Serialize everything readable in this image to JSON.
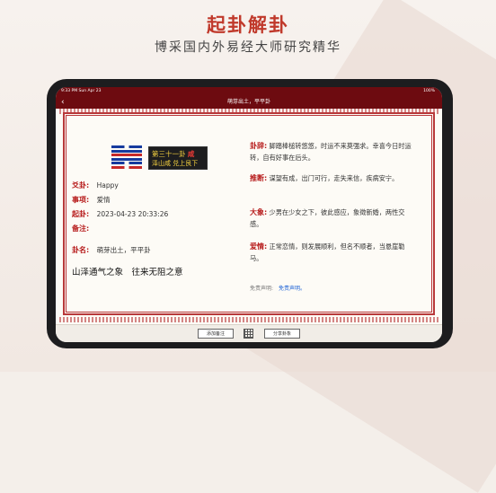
{
  "promo": {
    "headline": "起卦解卦",
    "subheadline": "博采国内外易经大师研究精华"
  },
  "status_bar": {
    "time": "9:33 PM  Sun Apr 23",
    "battery": "100%"
  },
  "nav": {
    "back": "‹",
    "title": "萌芽出土，平平卦"
  },
  "hexagram": {
    "title_prefix": "第三十一卦",
    "title_name": "咸",
    "subtitle": "泽山咸 兑上艮下"
  },
  "details": {
    "asker_label": "爻卦:",
    "asker_value": "Happy",
    "matter_label": "事项:",
    "matter_value": "爱情",
    "time_label": "起卦:",
    "time_value": "2023-04-23 20:33:26",
    "note_label": "备注:",
    "name_label": "卦名:",
    "name_value": "萌芽出土，平平卦",
    "summary": "山泽通气之象　往来无阻之意"
  },
  "interpretation": {
    "guaci_label": "卦辞:",
    "guaci_text": "脚踏棒槌转悠悠，时运不来莫强求。幸喜今日时运转，自有好事在后头。",
    "tuiduan_label": "推断:",
    "tuiduan_text": "谋望有成，出门可行，走失来信，疾病安宁。",
    "daxiang_label": "大象:",
    "daxiang_text": "少男在少女之下，彼此感应，象徵新婚，两性交感。",
    "aiqing_label": "爱情:",
    "aiqing_text": "正常恋情，则发展顺利，但名不顺者，当悬崖勒马。"
  },
  "disclaimer": {
    "label": "免责声明:",
    "link": "免责声明。"
  },
  "toolbar": {
    "add_note": "添加备注",
    "share": "分享卦象"
  },
  "colors": {
    "brand_red": "#6d0b10",
    "label_red": "#b71c1c",
    "hexagram_blue": "#163a9e"
  }
}
